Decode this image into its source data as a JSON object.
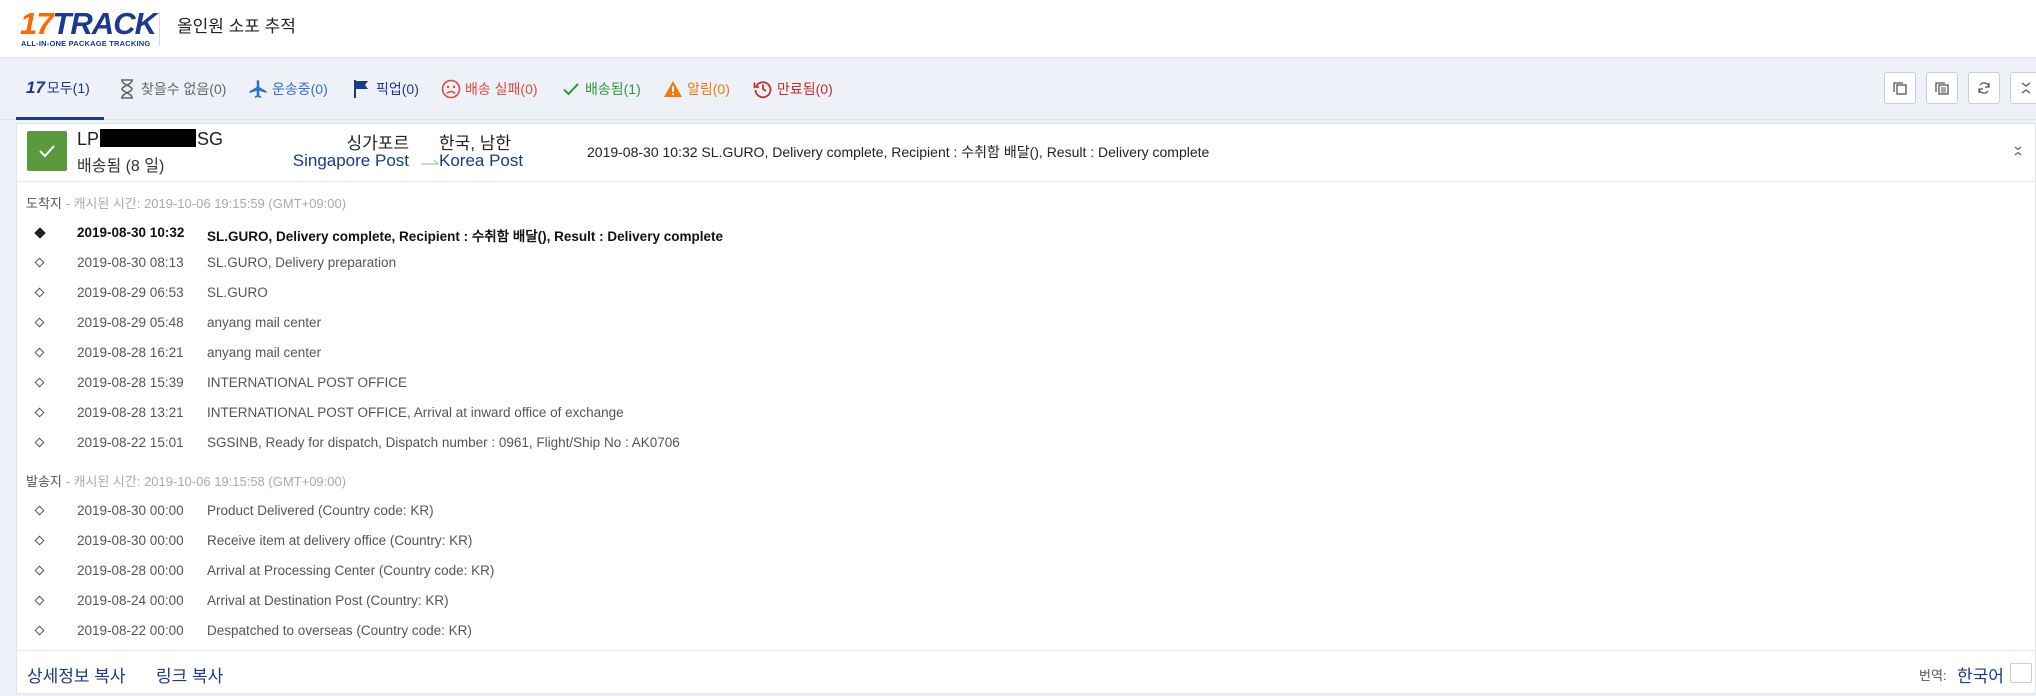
{
  "header": {
    "logo_num": "17",
    "logo_text": "TRACK",
    "logo_tagline": "ALL-IN-ONE PACKAGE TRACKING",
    "title": "올인원 소포 추적"
  },
  "tabs": [
    {
      "label": "모두(1)",
      "icon": "17track-icon"
    },
    {
      "label": "찾을수 없음(0)",
      "icon": "hourglass-icon"
    },
    {
      "label": "운송중(0)",
      "icon": "airplane-icon"
    },
    {
      "label": "픽업(0)",
      "icon": "flag-icon"
    },
    {
      "label": "배송 실패(0)",
      "icon": "sad-face-icon"
    },
    {
      "label": "배송됨(1)",
      "icon": "checkmark-icon"
    },
    {
      "label": "알림(0)",
      "icon": "warning-icon"
    },
    {
      "label": "만료됨(0)",
      "icon": "history-icon"
    }
  ],
  "toolbar": [
    "copy-icon",
    "copy-all-icon",
    "refresh-icon",
    "collapse-icon"
  ],
  "shipment": {
    "tracking_prefix": "LP",
    "tracking_suffix": "SG",
    "status": "배송됨 (8 일)",
    "origin_country": "싱가포르",
    "origin_carrier": "Singapore Post",
    "dest_country": "한국, 남한",
    "dest_carrier": "Korea Post",
    "latest_event": "2019-08-30 10:32  SL.GURO, Delivery complete, Recipient : 수취함 배달(), Result : Delivery complete"
  },
  "destination": {
    "label": "도착지",
    "cache": " - 캐시된 시간: 2019-10-06 19:15:59 (GMT+09:00)",
    "events": [
      {
        "time": "2019-08-30 10:32",
        "desc": "SL.GURO, Delivery complete, Recipient : 수취함 배달(), Result : Delivery complete"
      },
      {
        "time": "2019-08-30 08:13",
        "desc": "SL.GURO, Delivery preparation"
      },
      {
        "time": "2019-08-29 06:53",
        "desc": "SL.GURO"
      },
      {
        "time": "2019-08-29 05:48",
        "desc": "anyang mail center"
      },
      {
        "time": "2019-08-28 16:21",
        "desc": "anyang mail center"
      },
      {
        "time": "2019-08-28 15:39",
        "desc": "INTERNATIONAL POST OFFICE"
      },
      {
        "time": "2019-08-28 13:21",
        "desc": "INTERNATIONAL POST OFFICE, Arrival at inward office of exchange"
      },
      {
        "time": "2019-08-22 15:01",
        "desc": "SGSINB, Ready for dispatch, Dispatch number : 0961, Flight/Ship No : AK0706"
      }
    ]
  },
  "origin": {
    "label": "발송지",
    "cache": " - 캐시된 시간: 2019-10-06 19:15:58 (GMT+09:00)",
    "events": [
      {
        "time": "2019-08-30 00:00",
        "desc": "Product Delivered (Country code: KR)"
      },
      {
        "time": "2019-08-30 00:00",
        "desc": "Receive item at delivery office (Country: KR)"
      },
      {
        "time": "2019-08-28 00:00",
        "desc": "Arrival at Processing Center (Country code: KR)"
      },
      {
        "time": "2019-08-24 00:00",
        "desc": "Arrival at Destination Post (Country: KR)"
      },
      {
        "time": "2019-08-22 00:00",
        "desc": "Despatched to overseas (Country code: KR)"
      }
    ]
  },
  "footer": {
    "copy_details": "상세정보 복사",
    "copy_link": "링크 복사",
    "translate_label": "번역:",
    "translate_value": "한국어"
  },
  "colors": {
    "brand_navy": "#1a3a8f",
    "brand_orange": "#ff6a00",
    "delivered_green": "#5a9a3c"
  }
}
